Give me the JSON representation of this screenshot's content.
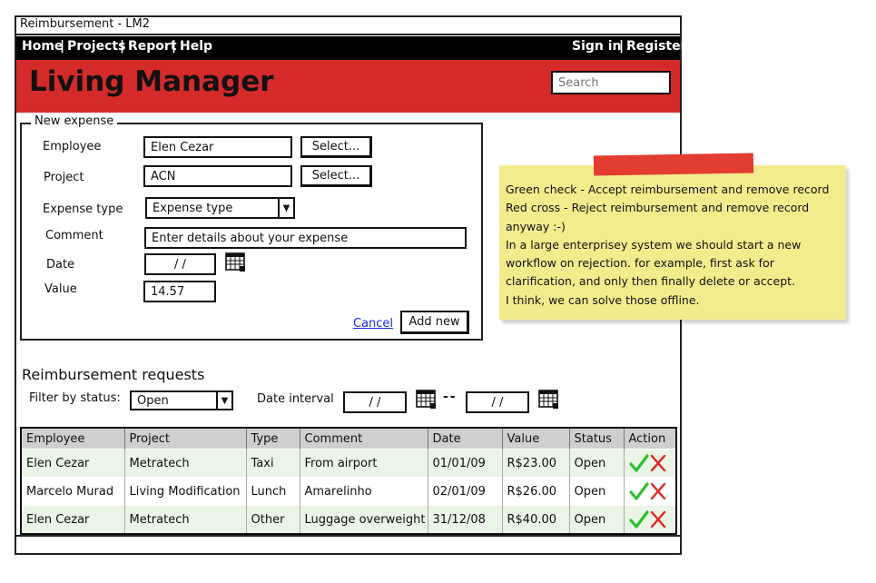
{
  "window": {
    "title": "Reimbursement - LM2"
  },
  "nav": {
    "home": "Home",
    "projects": "Projects",
    "report": "Report",
    "help": "Help",
    "sign_in": "Sign in",
    "register": "Register",
    "separator": "|"
  },
  "header": {
    "app_title": "Living Manager",
    "search_placeholder": "Search"
  },
  "form": {
    "legend": "New expense",
    "employee_label": "Employee",
    "employee_value": "Elen Cezar",
    "project_label": "Project",
    "project_value": "ACN",
    "select_label": "Select...",
    "expense_type_label": "Expense type",
    "expense_type_value": "Expense type",
    "comment_label": "Comment",
    "comment_value": "Enter details about your expense",
    "date_label": "Date",
    "date_value": "/ /",
    "value_label": "Value",
    "value_value": "14.57",
    "cancel": "Cancel",
    "add_new": "Add new"
  },
  "note": {
    "lines": [
      "Green check - Accept reimbursement and remove record",
      "Red cross - Reject reimbursement and remove record",
      "anyway :-)",
      "In a large enterprisey system we should start a new",
      "workflow on rejection. for example, first ask for",
      "clarification, and only then finally delete or accept.",
      "I think, we can solve those offline."
    ]
  },
  "requests": {
    "heading": "Reimbursement requests",
    "filter_label": "Filter by status:",
    "filter_value": "Open",
    "interval_label": "Date interval",
    "date_from": "/ /",
    "date_to": "/ /",
    "dash": "--",
    "columns": [
      "Employee",
      "Project",
      "Type",
      "Comment",
      "Date",
      "Value",
      "Status",
      "Action"
    ],
    "rows": [
      [
        "Elen Cezar",
        "Metratech",
        "Taxi",
        "From airport",
        "01/01/09",
        "R$23.00",
        "Open"
      ],
      [
        "Marcelo Murad",
        "Living Modification",
        "Lunch",
        "Amarelinho",
        "02/01/09",
        "R$26.00",
        "Open"
      ],
      [
        "Elen Cezar",
        "Metratech",
        "Other",
        "Luggage overweight",
        "31/12/08",
        "R$40.00",
        "Open"
      ]
    ]
  },
  "colors": {
    "header_red": "#d52a2a",
    "note_yellow": "#f3ec8d",
    "tape_red": "#e33d31",
    "accept_green": "#2fbf2f",
    "reject_red": "#e32424",
    "link_blue": "#1a2be0"
  },
  "icons": {
    "calendar": "calendar-icon",
    "accept": "check-icon",
    "reject": "cross-icon",
    "dropdown": "chevron-down-icon"
  }
}
